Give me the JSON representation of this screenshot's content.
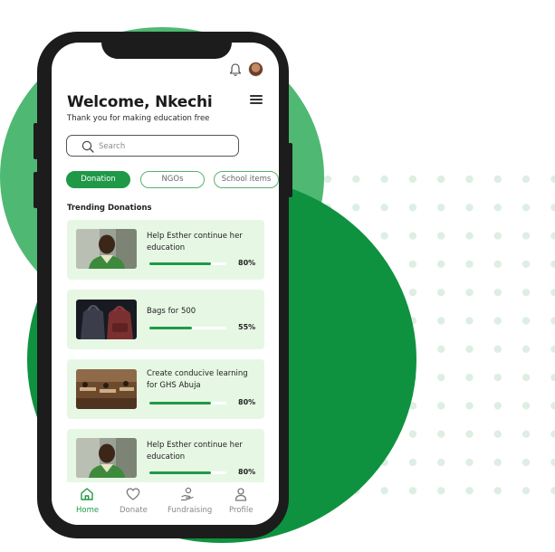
{
  "header": {
    "welcome": "Welcome, Nkechi",
    "subtitle": "Thank you for making education free"
  },
  "icons": {
    "bell": "bell-icon",
    "avatar": "user-avatar",
    "menu": "menu-icon",
    "search": "search-icon"
  },
  "search": {
    "placeholder": "Search"
  },
  "chips": [
    {
      "label": "Donation",
      "active": true
    },
    {
      "label": "NGOs",
      "active": false
    },
    {
      "label": "School items",
      "active": false
    }
  ],
  "section": {
    "title": "Trending Donations"
  },
  "donations": [
    {
      "title": "Help Esther continue her education",
      "progress": 0.8,
      "percent": "80%",
      "image": "girl-portrait"
    },
    {
      "title": "Bags for 500",
      "progress": 0.55,
      "percent": "55%",
      "image": "school-bags"
    },
    {
      "title": "Create conducive learning for GHS Abuja",
      "progress": 0.8,
      "percent": "80%",
      "image": "classroom"
    },
    {
      "title": "Help Esther continue her education",
      "progress": 0.8,
      "percent": "80%",
      "image": "girl-portrait"
    }
  ],
  "tabs": [
    {
      "label": "Home",
      "icon": "home-icon",
      "active": true
    },
    {
      "label": "Donate",
      "icon": "heart-icon",
      "active": false
    },
    {
      "label": "Fundraising",
      "icon": "hand-coin-icon",
      "active": false
    },
    {
      "label": "Profile",
      "icon": "user-icon",
      "active": false
    }
  ],
  "colors": {
    "brand_green": "#1f9947",
    "card_background": "#e6f8e4",
    "blob_light": "#4fb873",
    "blob_dark": "#0e923f"
  }
}
